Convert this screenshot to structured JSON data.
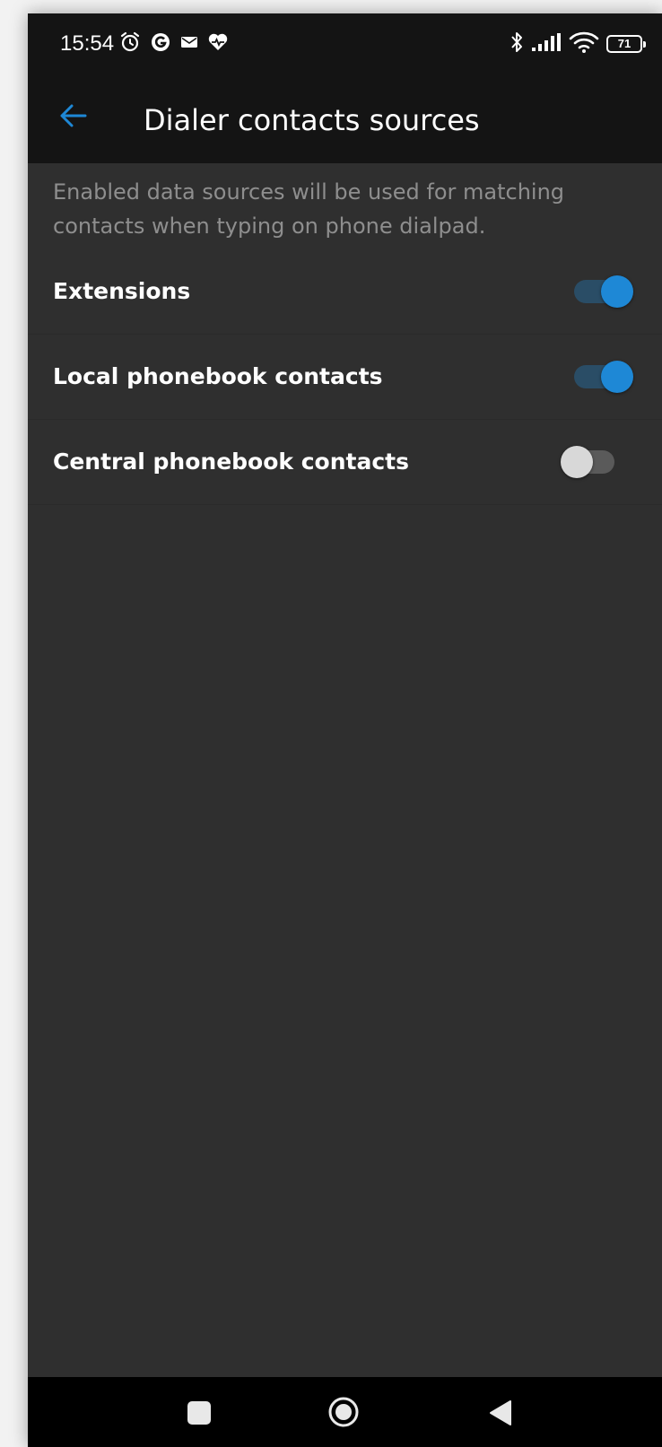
{
  "status_bar": {
    "time": "15:54",
    "battery_level": "71",
    "icons_left": [
      "alarm-icon",
      "g-icon",
      "mail-icon",
      "health-icon"
    ],
    "icons_right": [
      "bluetooth-icon",
      "signal-icon",
      "wifi-icon",
      "battery-icon"
    ]
  },
  "app_bar": {
    "title": "Dialer contacts sources",
    "back_icon": "arrow-left-icon"
  },
  "description": "Enabled data sources will be used for matching contacts when typing on phone dialpad.",
  "settings": [
    {
      "label": "Extensions",
      "enabled": true
    },
    {
      "label": "Local phonebook contacts",
      "enabled": true
    },
    {
      "label": "Central phonebook contacts",
      "enabled": false
    }
  ],
  "nav_bar": {
    "icons": [
      "recents-square-icon",
      "home-circle-icon",
      "back-triangle-icon"
    ]
  },
  "colors": {
    "background": "#2f2f2f",
    "bar": "#141414",
    "accent": "#1e88d6",
    "text_secondary": "#8e8e8e"
  }
}
